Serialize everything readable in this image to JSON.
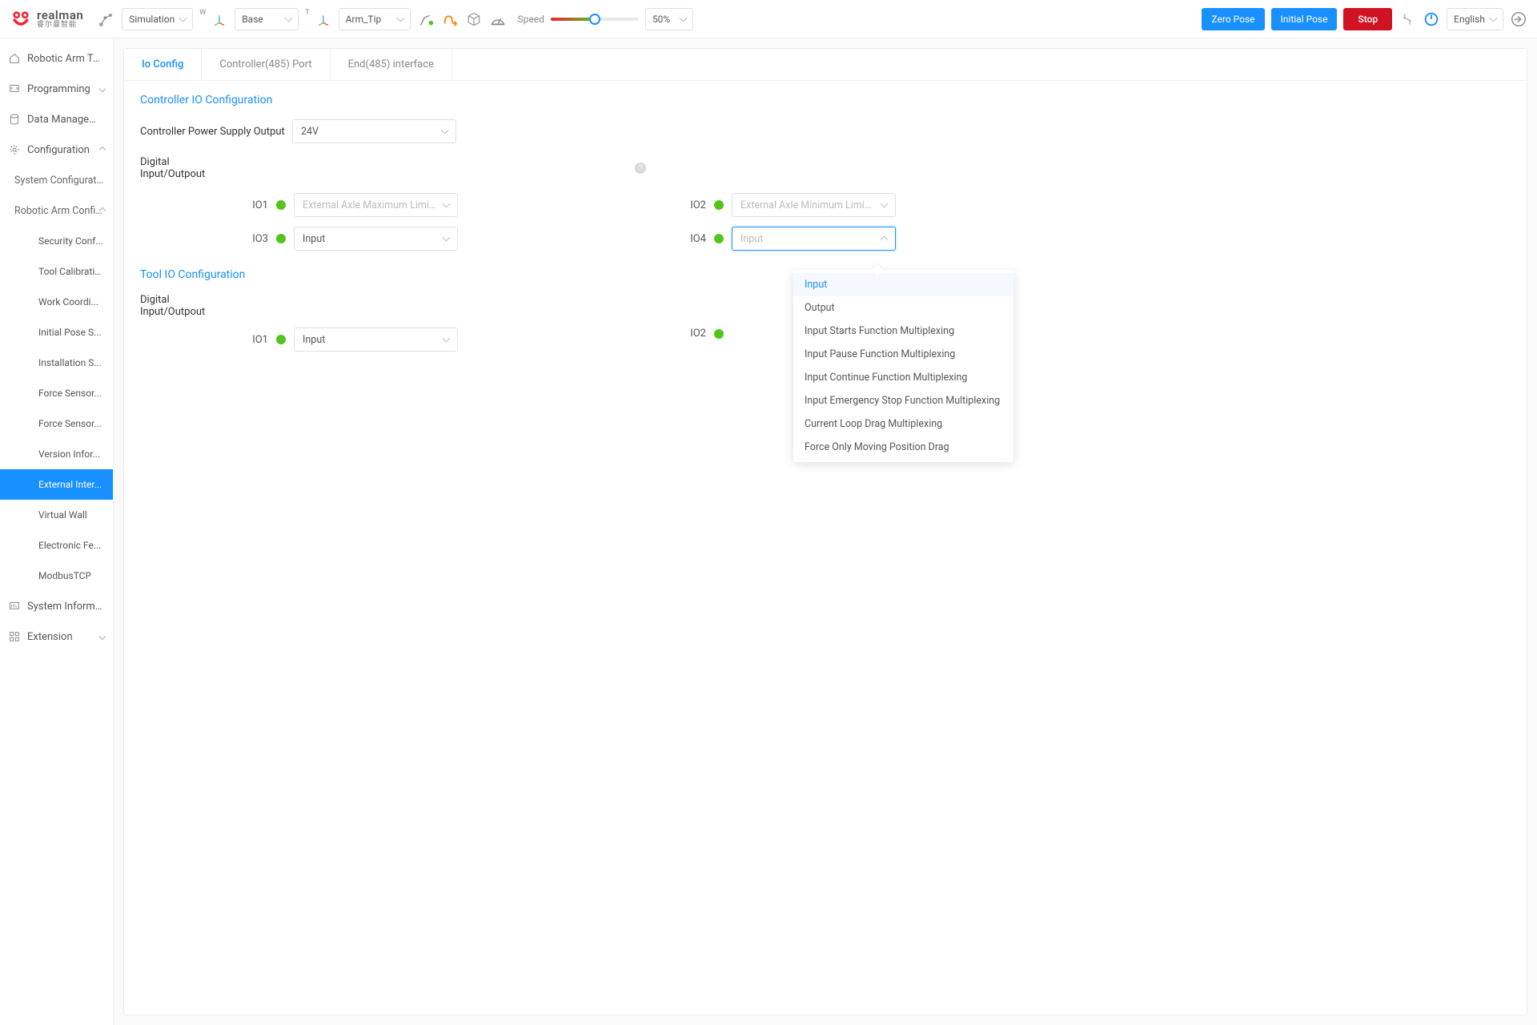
{
  "header": {
    "brand": {
      "name": "realman",
      "sub": "睿尔曼智能"
    },
    "mode": "Simulation",
    "base_label": "Base",
    "tool_label": "Arm_Tip",
    "speed_label": "Speed",
    "speed_value": "50%",
    "speed_percent": 50,
    "zero_pose": "Zero Pose",
    "initial_pose": "Initial Pose",
    "stop": "Stop",
    "language": "English"
  },
  "sidebar": {
    "items": [
      {
        "label": "Robotic Arm Tea..."
      },
      {
        "label": "Programming",
        "expand": "down"
      },
      {
        "label": "Data Management"
      },
      {
        "label": "Configuration",
        "expand": "up"
      }
    ],
    "config_children": [
      {
        "label": "System Configuration"
      },
      {
        "label": "Robotic Arm Config...",
        "expand": "up"
      }
    ],
    "arm_children": [
      {
        "label": "Security Conf..."
      },
      {
        "label": "Tool Calibration"
      },
      {
        "label": "Work Coordi..."
      },
      {
        "label": "Initial Pose S..."
      },
      {
        "label": "Installation S..."
      },
      {
        "label": "Force Sensor..."
      },
      {
        "label": "Force Sensor..."
      },
      {
        "label": "Version Infor..."
      },
      {
        "label": "External Inter...",
        "active": true
      },
      {
        "label": "Virtual Wall"
      },
      {
        "label": "Electronic Fe..."
      },
      {
        "label": "ModbusTCP"
      }
    ],
    "tail": [
      {
        "label": "System Informat..."
      },
      {
        "label": "Extension",
        "expand": "down"
      }
    ]
  },
  "tabs": [
    {
      "label": "Io Config",
      "active": true
    },
    {
      "label": "Controller(485) Port"
    },
    {
      "label": "End(485) interface"
    }
  ],
  "controller_io": {
    "title": "Controller IO Configuration",
    "power_label": "Controller Power Supply Output",
    "power_value": "24V",
    "digital_label": "Digital Input/Outpout",
    "io1_label": "IO1",
    "io1_value": "External Axle Maximum Limit Dr...",
    "io2_label": "IO2",
    "io2_value": "External Axle Minimum Limit Dr...",
    "io3_label": "IO3",
    "io3_value": "Input",
    "io4_label": "IO4",
    "io4_value": "Input"
  },
  "tool_io": {
    "title": "Tool IO Configuration",
    "digital_label": "Digital Input/Outpout",
    "io1_label": "IO1",
    "io1_value": "Input",
    "io2_label": "IO2"
  },
  "dropdown": {
    "items": [
      "Input",
      "Output",
      "Input Starts Function Multiplexing",
      "Input Pause Function Multiplexing",
      "Input Continue Function Multiplexing",
      "Input Emergency Stop Function Multiplexing",
      "Current Loop Drag Multiplexing",
      "Force Only Moving Position Drag"
    ]
  }
}
